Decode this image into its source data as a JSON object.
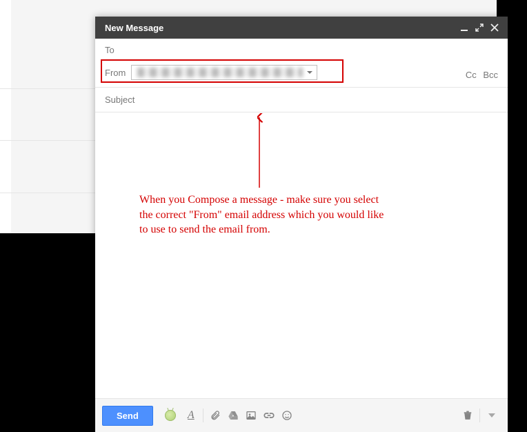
{
  "header": {
    "title": "New Message"
  },
  "recipients": {
    "to_label": "To",
    "from_label": "From",
    "from_email_masked": "████████ ████ ██████████.com",
    "cc_label": "Cc",
    "bcc_label": "Bcc"
  },
  "subject": {
    "placeholder": "Subject"
  },
  "annotation": {
    "text": "When you Compose a message - make sure you select the correct \"From\" email address which you would like to use to send the email from."
  },
  "toolbar": {
    "send_label": "Send"
  },
  "icons": {
    "minimize": "minimize-icon",
    "maximize": "expand-icon",
    "close": "close-icon",
    "format": "format-icon",
    "attach": "attach-icon",
    "drive": "drive-icon",
    "photo": "photo-icon",
    "link": "link-icon",
    "emoji": "emoji-icon",
    "trash": "trash-icon",
    "more": "more-icon",
    "extension": "greenbug-icon"
  }
}
